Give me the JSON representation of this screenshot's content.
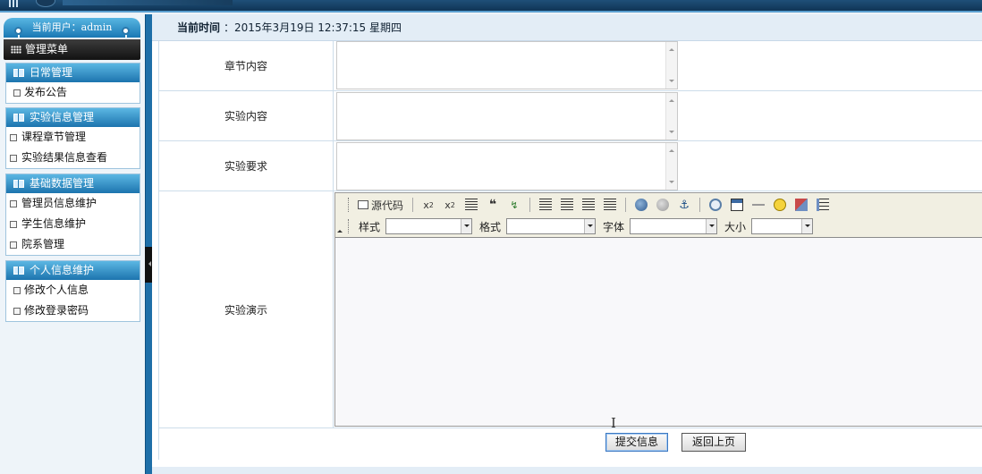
{
  "header": {
    "current_user": "当前用户：admin"
  },
  "sidebar": {
    "menu_title": "管理菜单",
    "groups": [
      {
        "title": "日常管理",
        "items": [
          "发布公告"
        ]
      },
      {
        "title": "实验信息管理",
        "items": [
          "课程章节管理",
          "实验结果信息查看"
        ]
      },
      {
        "title": "基础数据管理",
        "items": [
          "管理员信息维护",
          "学生信息维护",
          "院系管理"
        ]
      },
      {
        "title": "个人信息维护",
        "items": [
          "修改个人信息",
          "修改登录密码"
        ]
      }
    ]
  },
  "timebar": {
    "label": "当前时间",
    "value": "：2015年3月19日  12:37:15  星期四"
  },
  "form": {
    "rows": [
      {
        "label": "章节内容"
      },
      {
        "label": "实验内容"
      },
      {
        "label": "实验要求"
      },
      {
        "label": "实验演示"
      }
    ],
    "editor": {
      "source_label": "源代码",
      "style_label": "样式",
      "format_label": "格式",
      "font_label": "字体",
      "size_label": "大小"
    },
    "submit_label": "提交信息",
    "back_label": "返回上页"
  }
}
